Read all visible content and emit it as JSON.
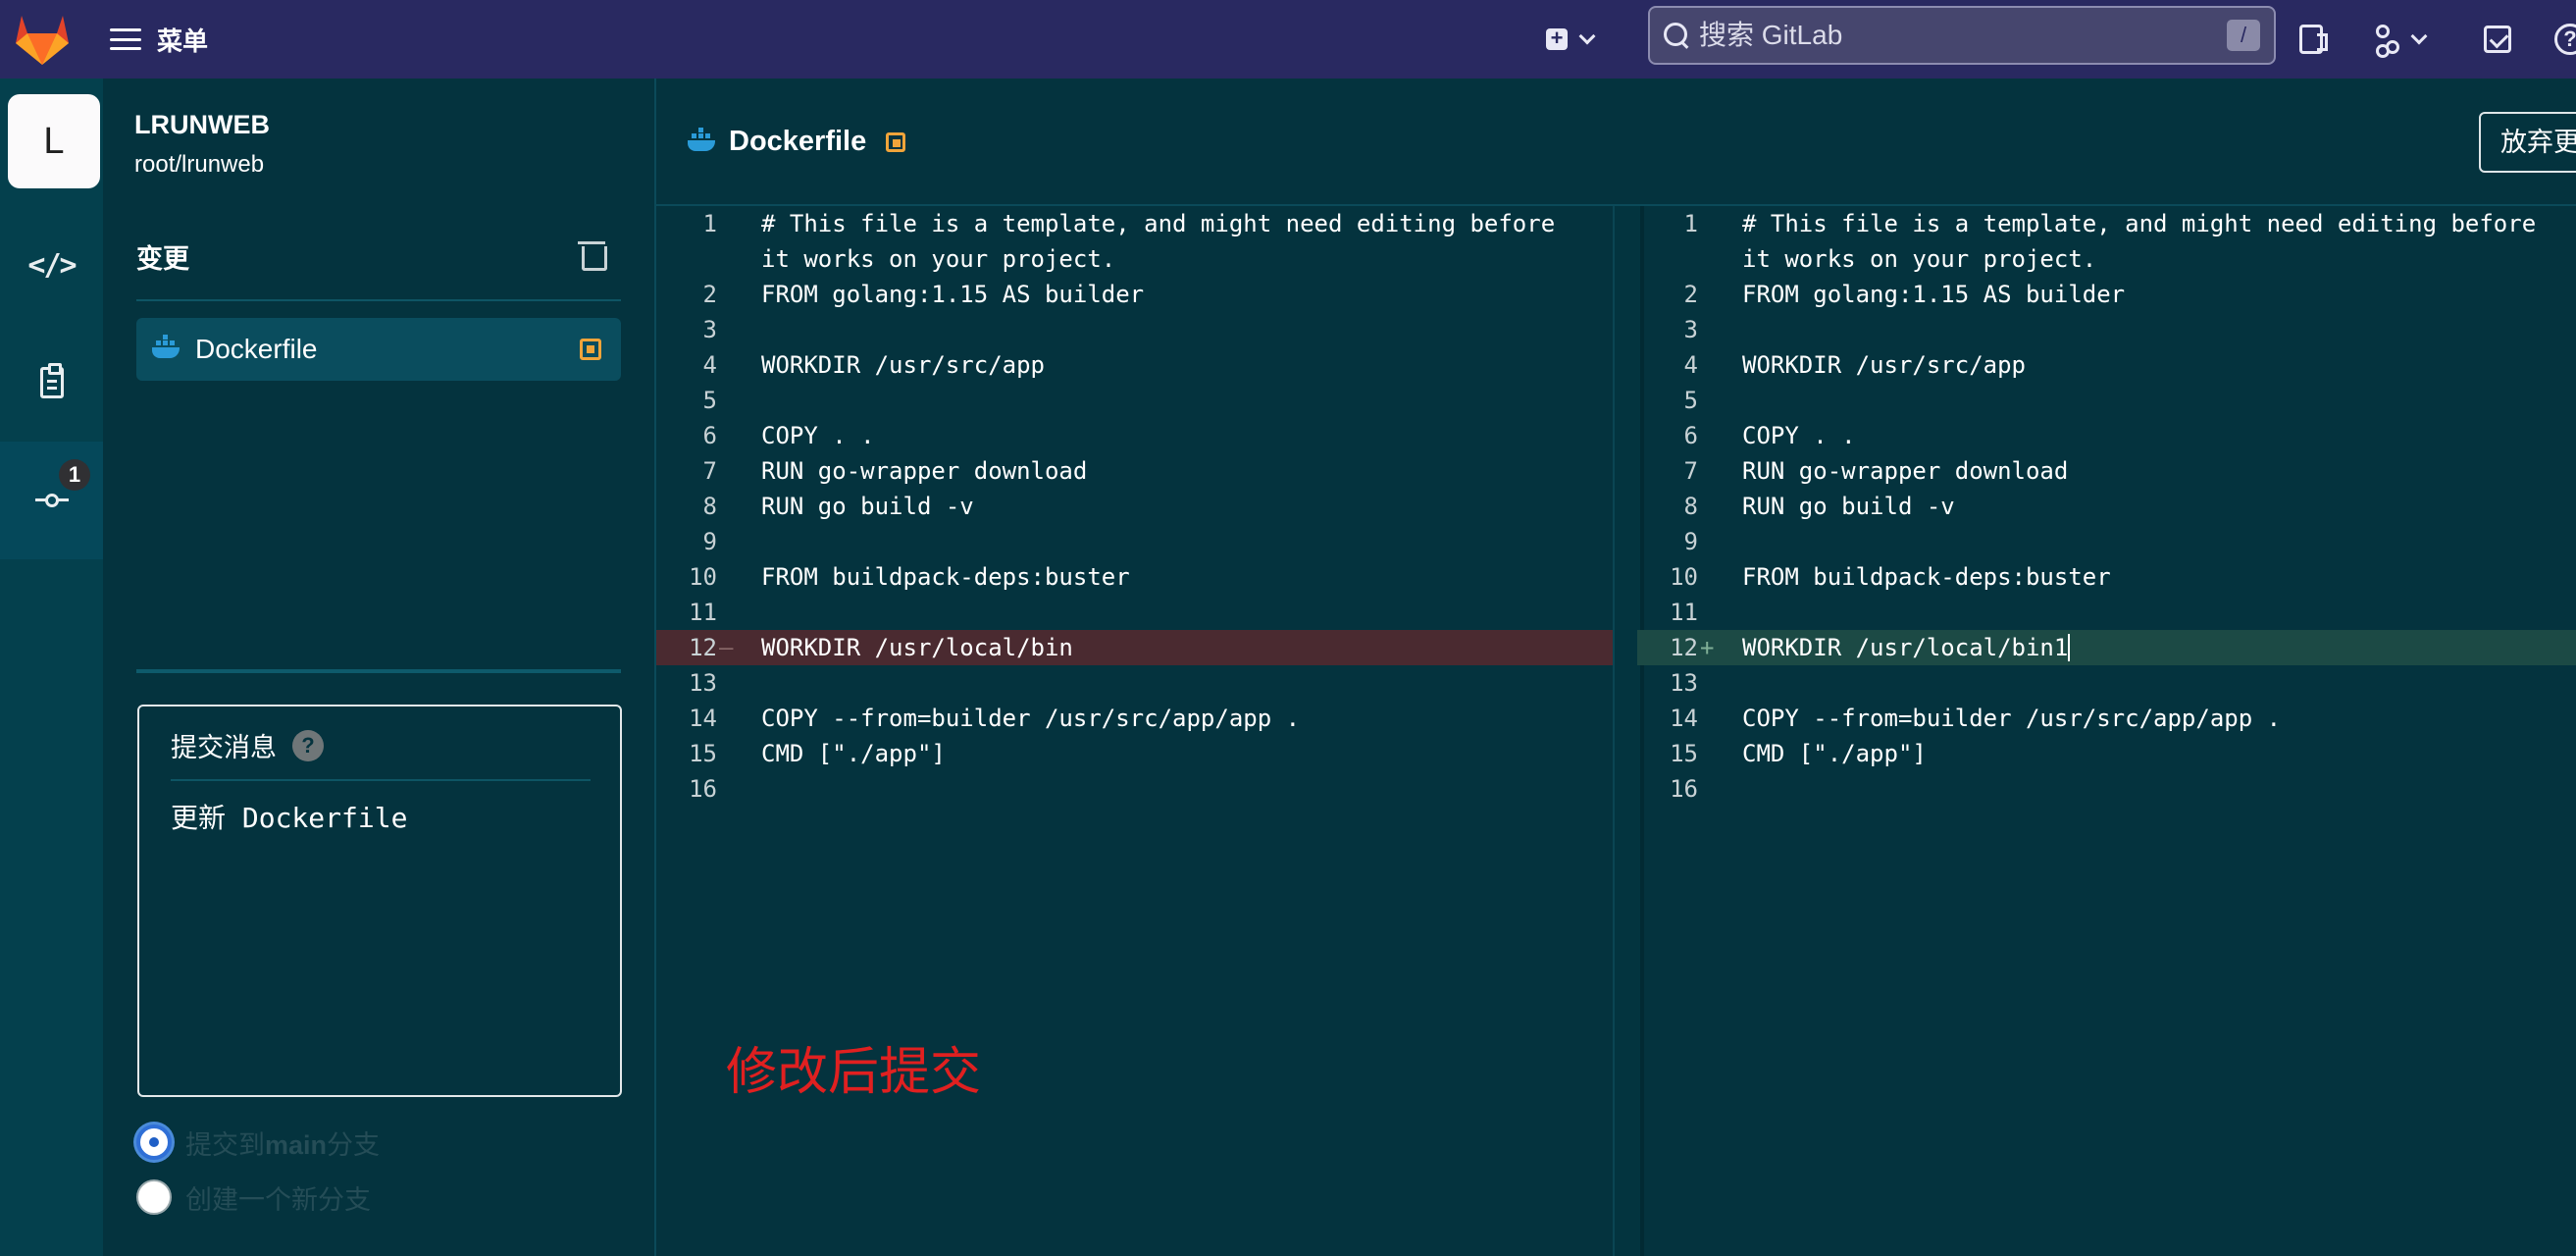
{
  "topbar": {
    "menu_label": "菜单",
    "search_placeholder": "搜索 GitLab",
    "search_shortcut": "/",
    "icons": [
      "gitlab-logo",
      "hamburger-icon",
      "plus-square-icon",
      "chevron-down-icon",
      "search-icon",
      "issues-icon",
      "merge-request-icon",
      "todo-icon",
      "help-icon"
    ]
  },
  "project": {
    "avatar_letter": "L",
    "name": "LRUNWEB",
    "path": "root/lrunweb"
  },
  "rail": {
    "commit_badge": "1"
  },
  "changes": {
    "title": "变更",
    "files": [
      {
        "name": "Dockerfile",
        "status": "modified"
      }
    ]
  },
  "commit": {
    "label": "提交消息",
    "message": "更新 Dockerfile",
    "options": [
      {
        "prefix": "提交到",
        "branch": "main",
        "suffix": "分支",
        "checked": true
      },
      {
        "label": "创建一个新分支",
        "checked": false
      }
    ]
  },
  "editor": {
    "file_title": "Dockerfile",
    "discard_label": "放弃更改",
    "left_lines": [
      {
        "n": "1",
        "code": "# This file is a template, and might need editing before"
      },
      {
        "n": "",
        "code": "it works on your project."
      },
      {
        "n": "2",
        "code": "FROM golang:1.15 AS builder"
      },
      {
        "n": "3",
        "code": ""
      },
      {
        "n": "4",
        "code": "WORKDIR /usr/src/app"
      },
      {
        "n": "5",
        "code": ""
      },
      {
        "n": "6",
        "code": "COPY . ."
      },
      {
        "n": "7",
        "code": "RUN go-wrapper download"
      },
      {
        "n": "8",
        "code": "RUN go build -v"
      },
      {
        "n": "9",
        "code": ""
      },
      {
        "n": "10",
        "code": "FROM buildpack-deps:buster"
      },
      {
        "n": "11",
        "code": ""
      },
      {
        "n": "12",
        "code": "WORKDIR /usr/local/bin",
        "type": "removed",
        "mark": "—"
      },
      {
        "n": "13",
        "code": ""
      },
      {
        "n": "14",
        "code": "COPY --from=builder /usr/src/app/app ."
      },
      {
        "n": "15",
        "code": "CMD [\"./app\"]"
      },
      {
        "n": "16",
        "code": ""
      }
    ],
    "right_lines": [
      {
        "n": "1",
        "code": "# This file is a template, and might need editing before"
      },
      {
        "n": "",
        "code": "it works on your project."
      },
      {
        "n": "2",
        "code": "FROM golang:1.15 AS builder"
      },
      {
        "n": "3",
        "code": ""
      },
      {
        "n": "4",
        "code": "WORKDIR /usr/src/app"
      },
      {
        "n": "5",
        "code": ""
      },
      {
        "n": "6",
        "code": "COPY . ."
      },
      {
        "n": "7",
        "code": "RUN go-wrapper download"
      },
      {
        "n": "8",
        "code": "RUN go build -v"
      },
      {
        "n": "9",
        "code": ""
      },
      {
        "n": "10",
        "code": "FROM buildpack-deps:buster"
      },
      {
        "n": "11",
        "code": ""
      },
      {
        "n": "12",
        "code": "WORKDIR /usr/local/bin1",
        "type": "added",
        "mark": "+"
      },
      {
        "n": "13",
        "code": ""
      },
      {
        "n": "14",
        "code": "COPY --from=builder /usr/src/app/app ."
      },
      {
        "n": "15",
        "code": "CMD [\"./app\"]"
      },
      {
        "n": "16",
        "code": ""
      }
    ]
  },
  "annotation": "修改后提交",
  "colors": {
    "navbar": "#292961",
    "background": "#04333e",
    "removed_line": "#4a2a30",
    "added_line": "#1c4a45",
    "modified_accent": "#f0a43a",
    "annotation": "#e02020"
  }
}
